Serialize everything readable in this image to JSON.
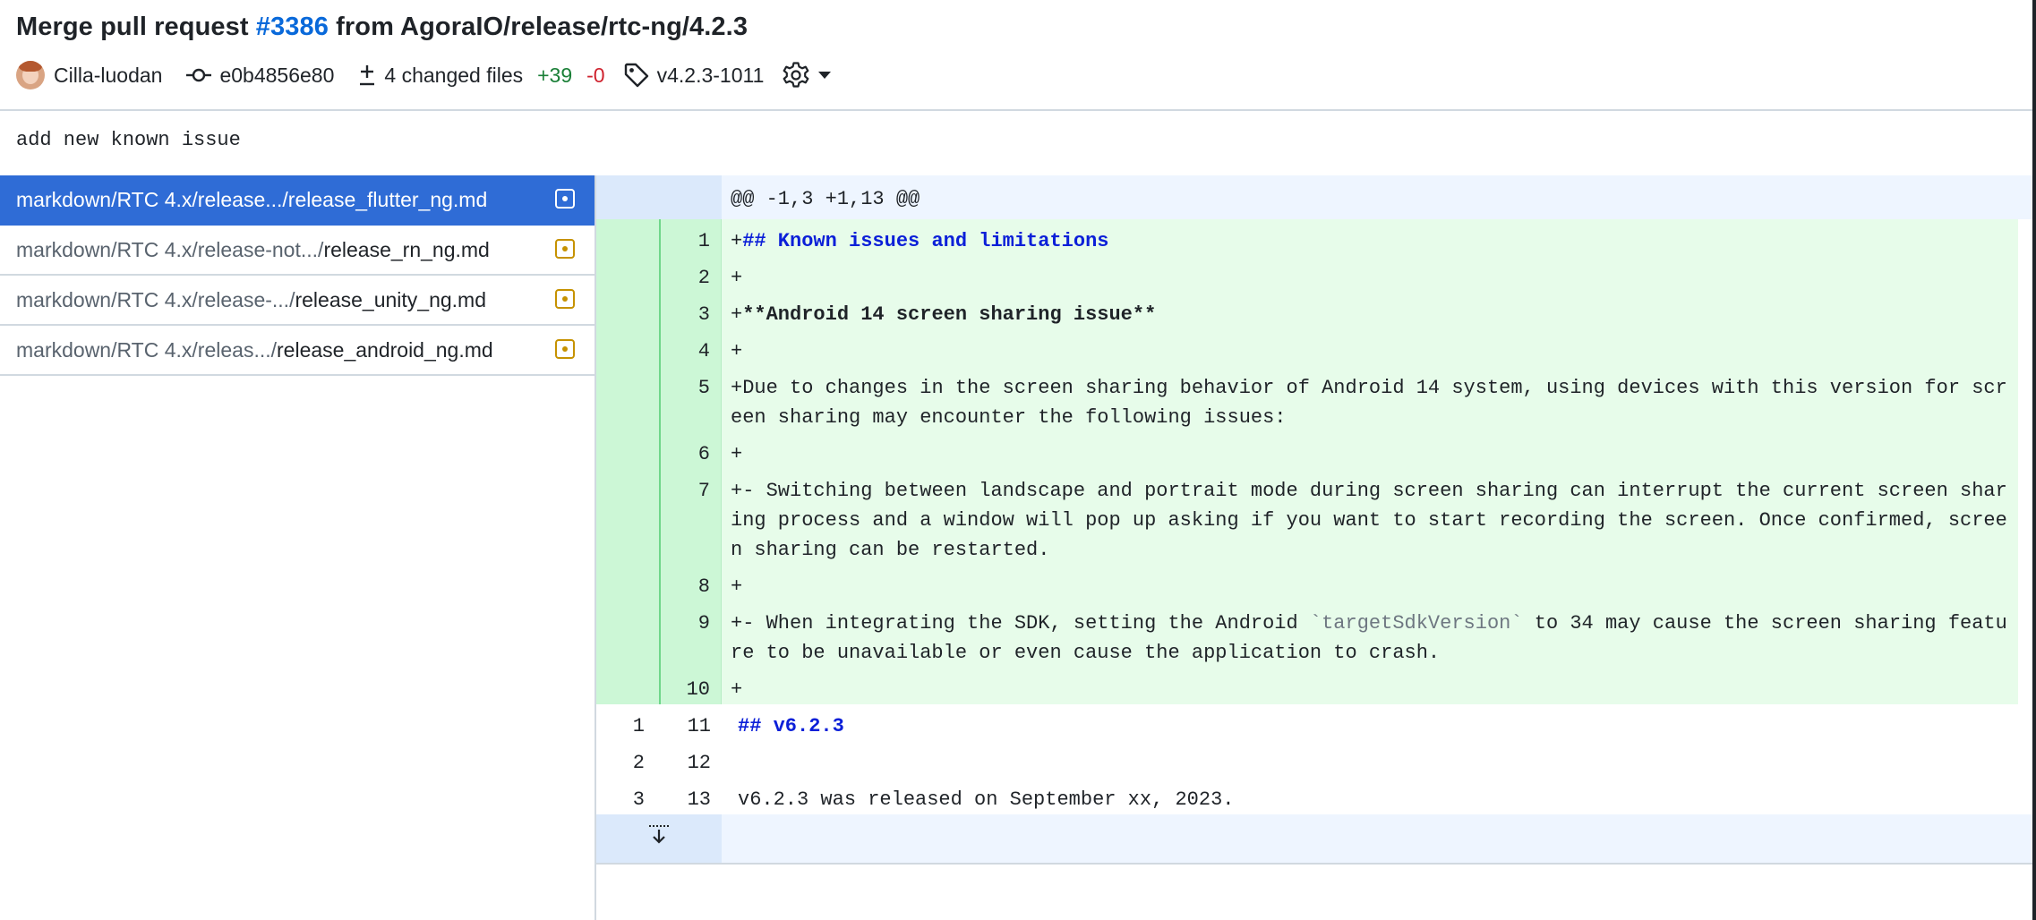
{
  "header": {
    "title_prefix": "Merge pull request ",
    "pr_number": "#3386",
    "title_suffix": " from AgoraIO/release/rtc-ng/4.2.3",
    "author": "Cilla-luodan",
    "commit": "e0b4856e80",
    "changed_files": "4 changed files",
    "additions": "+39",
    "deletions": "-0",
    "tag": "v4.2.3-1011"
  },
  "description": "add new known issue",
  "files": [
    {
      "dir": "markdown/RTC 4.x/release.../",
      "name": "release_flutter_ng.md",
      "active": true
    },
    {
      "dir": "markdown/RTC 4.x/release-not.../",
      "name": "release_rn_ng.md",
      "active": false
    },
    {
      "dir": "markdown/RTC 4.x/release-.../",
      "name": "release_unity_ng.md",
      "active": false
    },
    {
      "dir": "markdown/RTC 4.x/releas.../",
      "name": "release_android_ng.md",
      "active": false
    }
  ],
  "diff": {
    "hunk": "@@ -1,3 +1,13 @@",
    "lines": [
      {
        "old": "",
        "new": "1",
        "prefix": "+",
        "text": "## Known issues and limitations"
      },
      {
        "old": "",
        "new": "2",
        "prefix": "+",
        "text": ""
      },
      {
        "old": "",
        "new": "3",
        "prefix": "+",
        "text": "**Android 14 screen sharing issue**"
      },
      {
        "old": "",
        "new": "4",
        "prefix": "+",
        "text": ""
      },
      {
        "old": "",
        "new": "5",
        "prefix": "+",
        "text": "Due to changes in the screen sharing behavior of Android 14 system, using devices with this version for screen sharing may encounter the following issues:"
      },
      {
        "old": "",
        "new": "6",
        "prefix": "+",
        "text": ""
      },
      {
        "old": "",
        "new": "7",
        "prefix": "+",
        "text": "- Switching between landscape and portrait mode during screen sharing can interrupt the current screen sharing process and a window will pop up asking if you want to start recording the screen. Once confirmed, screen sharing can be restarted."
      },
      {
        "old": "",
        "new": "8",
        "prefix": "+",
        "text": ""
      },
      {
        "old": "",
        "new": "9",
        "prefix": "+",
        "text_before": "- When integrating the SDK, setting the Android ",
        "text_code": "`targetSdkVersion`",
        "text_after": " to 34 may cause the screen sharing feature to be unavailable or even cause the application to crash."
      },
      {
        "old": "",
        "new": "10",
        "prefix": "+",
        "text": ""
      },
      {
        "old": "1",
        "new": "11",
        "prefix": "",
        "text": "## v6.2.3"
      },
      {
        "old": "2",
        "new": "12",
        "prefix": "",
        "text": ""
      },
      {
        "old": "3",
        "new": "13",
        "prefix": "",
        "text": "v6.2.3 was released on September xx, 2023."
      }
    ]
  },
  "icons": {
    "commit": "git-commit-icon",
    "files": "diff-icon",
    "tag": "tag-icon",
    "settings": "gear-icon",
    "expand": "unfold-down-icon",
    "file_status": "file-modified-icon"
  },
  "colors": {
    "link": "#0969da",
    "addition": "#1a7f37",
    "deletion": "#cf222e",
    "active_file": "#2f6cd6",
    "added_line_bg": "#e7fcea",
    "added_gutter_bg": "#ccf7d6",
    "hunk_bg": "#eef5ff",
    "modified_badge": "#c69200",
    "heading_text": "#0b1fd8"
  }
}
